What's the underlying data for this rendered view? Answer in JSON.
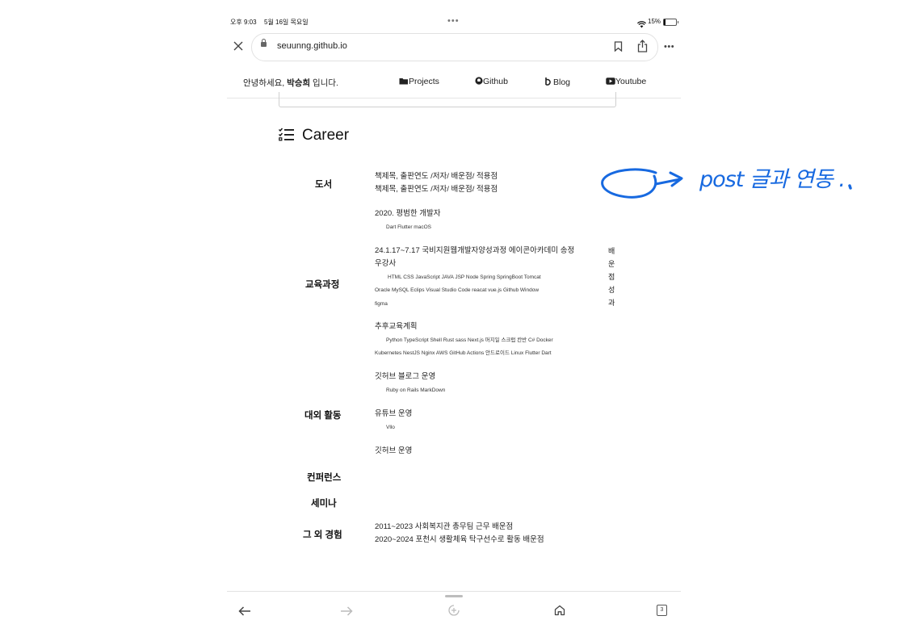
{
  "status_bar": {
    "time": "오후 9:03",
    "date": "5월 16일 목요일",
    "battery": "15%"
  },
  "browser": {
    "url": "seuunng.github.io"
  },
  "site_nav": {
    "greeting_prefix": "안녕하세요, ",
    "greeting_name": "박승희",
    "greeting_suffix": " 입니다.",
    "links": [
      "Projects",
      "Github",
      "Blog",
      "Youtube"
    ]
  },
  "section_title": "Career",
  "categories": {
    "books": "도서",
    "education": "교육과정",
    "external": "대외 활동",
    "conference": "컨퍼런스",
    "seminar": "세미나",
    "other": "그 외 경험"
  },
  "books": {
    "line1": "책제목, 출판연도 /저자/ 배운점/ 적용점",
    "line2": "책제목, 출판연도 /저자/ 배운점/ 적용점"
  },
  "education": {
    "e1_title": "2020. 평범한 개발자",
    "e1_tags": "Dart Flutter macOS",
    "e2_title_1": "24.1.17~7.17 국비지원웹개발자양성과정 에이콘아카데미 송정",
    "e2_title_2": "우강사",
    "e2_tags_1": "HTML CSS JavaScript JAVA JSP Node Spring SpringBoot Tomcat",
    "e2_tags_2": "Oracle MySQL Eclips Visual Studio Code reacat vue.js Github Window",
    "e2_tags_3": "figma",
    "e2_side": [
      "배",
      "운",
      "점",
      "성",
      "과"
    ],
    "e3_title": "추후교육계획",
    "e3_tags_1": "Python TypeScript Shell Rust sass Next.js 머지일 스크럽 칸반 C# Docker",
    "e3_tags_2": "Kubernetes NestJS Nginx AWS GitHub Actions 안드로이드 Linux Flutter Dart"
  },
  "external": {
    "a1_title": "깃허브 블로그 운영",
    "a1_tags": "Ruby on Rails MarkDown",
    "a2_title": "유튜브 운영",
    "a2_tags": "Vllo",
    "a3_title": "깃허브 운영"
  },
  "other": {
    "line1": "2011~2023 사회복지관 총무팀 근무 배운점",
    "line2": "2020~2024 포천시 생활체육 탁구선수로 활동 배운점"
  },
  "annotation": {
    "text": "post 글과 연동 ."
  },
  "toolbar": {
    "tab_count": "3"
  },
  "colors": {
    "annotation_blue": "#1769e0"
  }
}
